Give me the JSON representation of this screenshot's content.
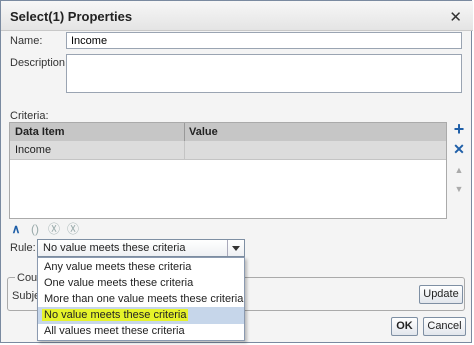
{
  "window": {
    "title": "Select(1) Properties",
    "close_glyph": "✕"
  },
  "name_field": {
    "label": "Name:",
    "value": "Income"
  },
  "description_field": {
    "label": "Description:",
    "value": ""
  },
  "criteria": {
    "label": "Criteria:",
    "columns": [
      "Data Item",
      "Value"
    ],
    "rows": [
      {
        "data_item": "Income",
        "value": ""
      }
    ]
  },
  "side_toolbar": {
    "add": "+",
    "delete": "✕",
    "move_up": "▲",
    "move_down": "▼"
  },
  "criteria_toolbar": {
    "and": "∧",
    "group": "()",
    "ungroup": "Ⓧ",
    "negate": "Ⓧ"
  },
  "rule": {
    "label": "Rule:",
    "selected": "No value meets these criteria",
    "options": [
      "Any value meets these criteria",
      "One value meets these criteria",
      "More than one value meets these criteria",
      "No value meets these criteria",
      "All values meet these criteria"
    ]
  },
  "group": {
    "legend": "Cou",
    "subject_label": "Subje",
    "update_button": "Update"
  },
  "footer": {
    "ok": "OK",
    "cancel": "Cancel"
  },
  "colors": {
    "highlight": "#e6f32a",
    "selected_row": "#c6d6ea",
    "accent_icon": "#1f5fa8"
  }
}
